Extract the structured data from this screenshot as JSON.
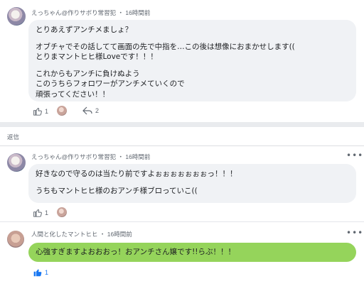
{
  "comments": [
    {
      "author": "えっちゃん@作りサボり常習犯",
      "time": "16時間前",
      "lines": [
        "とりあえずアンチメましょ？",
        "",
        "オブチャでその話してて画面の先で中指を…この後は想像におまかせします((",
        "とりまマントヒヒ様Loveです！！！",
        "",
        "これからもアンチに負けぬよう",
        "このうちらフォロワーがアンチメていくので",
        "頑張ってください！！"
      ],
      "like_count": "1",
      "reply_count": "2"
    },
    {
      "author": "えっちゃん@作りサボり常習犯",
      "time": "16時間前",
      "lines": [
        "好きなので守るのは当たり前ですよぉぉぉぉぉぉぉっ！！！",
        "",
        "うちもマントヒヒ様のおアンチ様ブロっていこ(("
      ],
      "like_count": "1"
    },
    {
      "author": "人間と化したマントヒヒ",
      "time": "16時間前",
      "lines": [
        "心強すぎますよおおおっ！おアンチさん嬢です!!らぶ！！！"
      ],
      "like_count": "1"
    }
  ],
  "section_label": "返信",
  "separator": "・",
  "more_glyph": "•••",
  "colors": {
    "bubble_gray": "#f0f2f5",
    "bubble_green": "#95d45b",
    "like_active": "#1877f2",
    "meta_text": "#606770"
  }
}
